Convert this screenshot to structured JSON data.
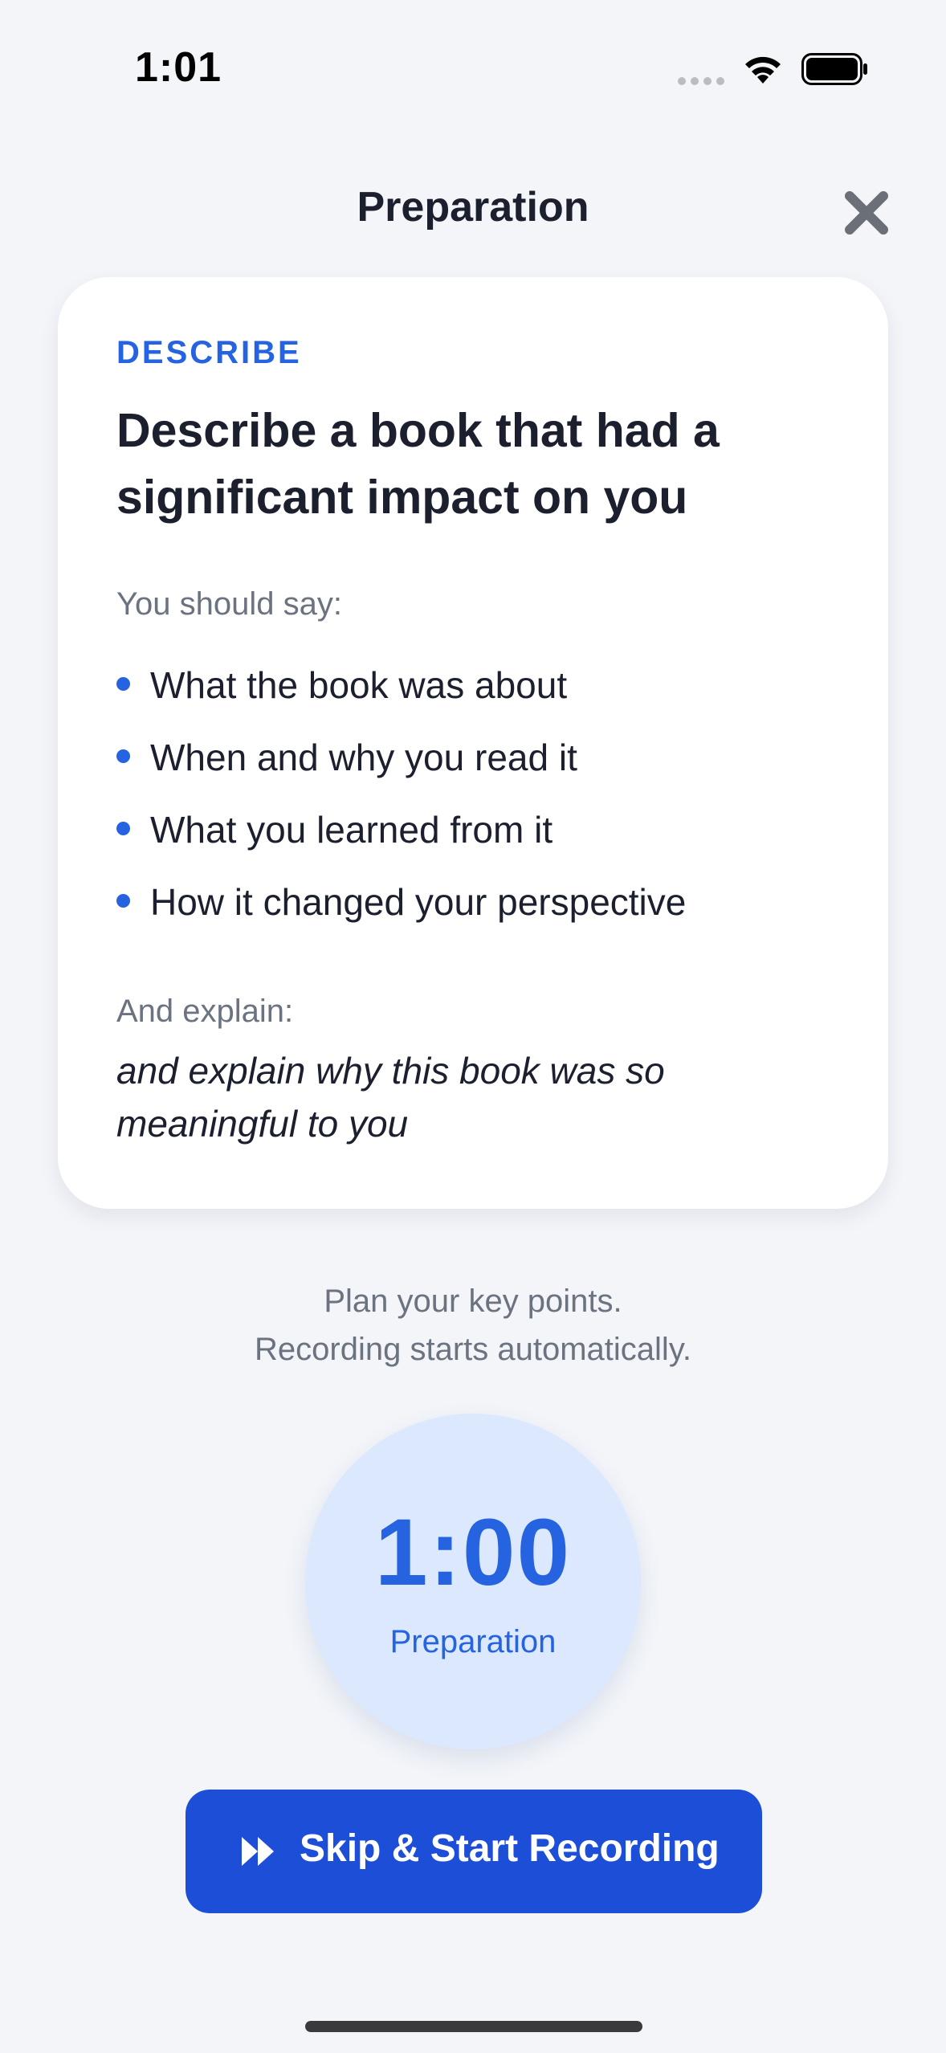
{
  "status_bar": {
    "time": "1:01"
  },
  "header": {
    "title": "Preparation",
    "close_icon": "close-icon"
  },
  "card": {
    "category": "DESCRIBE",
    "title": "Describe a book that had a significant impact on you",
    "should_say_label": "You should say:",
    "points": [
      "What the book was about",
      "When and why you read it",
      "What you learned from it",
      "How it changed your perspective"
    ],
    "explain_label": "And explain:",
    "explain_text": "and explain why this book was so meaningful to you"
  },
  "instructions": {
    "line1": "Plan your key points.",
    "line2": "Recording starts automatically."
  },
  "timer": {
    "value": "1:00",
    "label": "Preparation"
  },
  "skip_button": {
    "label": "Skip & Start Recording",
    "icon": "fast-forward-icon"
  },
  "colors": {
    "accent": "#2663e0",
    "button": "#1d4ed8",
    "timer_bg": "#dbe8fd",
    "page_bg": "#f3f5f9"
  }
}
